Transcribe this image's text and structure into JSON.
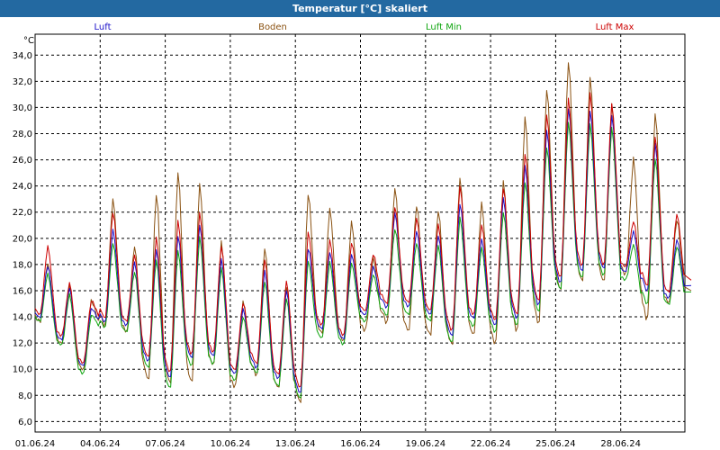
{
  "window": {
    "title": "Temperatur [°C] skaliert"
  },
  "colors": {
    "frame_bg": "#2369a1",
    "Luft": "#1a0fc8",
    "Boden": "#8a5212",
    "Luft Min": "#10a510",
    "Luft Max": "#cc0000"
  },
  "chart_data": {
    "type": "line",
    "title": "Temperatur [°C] skaliert",
    "ylabel": "°C",
    "xlabel": "",
    "ylim": [
      5.2,
      35.6
    ],
    "xlim": [
      "01.06.24",
      "01.07.24 06:00"
    ],
    "grid": true,
    "legend_placement": "top",
    "y_ticks": [
      "6,0",
      "8,0",
      "10,0",
      "12,0",
      "14,0",
      "16,0",
      "18,0",
      "20,0",
      "22,0",
      "24,0",
      "26,0",
      "28,0",
      "30,0",
      "32,0",
      "34,0"
    ],
    "x_ticks": [
      "01.06.24",
      "04.06.24",
      "07.06.24",
      "10.06.24",
      "13.06.24",
      "16.06.24",
      "19.06.24",
      "22.06.24",
      "25.06.24",
      "28.06.24"
    ],
    "x": [
      "01.06.24",
      "02.06.24",
      "03.06.24",
      "04.06.24",
      "05.06.24",
      "06.06.24",
      "07.06.24",
      "08.06.24",
      "09.06.24",
      "10.06.24",
      "11.06.24",
      "12.06.24",
      "13.06.24",
      "14.06.24",
      "15.06.24",
      "16.06.24",
      "17.06.24",
      "18.06.24",
      "19.06.24",
      "20.06.24",
      "21.06.24",
      "22.06.24",
      "23.06.24",
      "24.06.24",
      "25.06.24",
      "26.06.24",
      "27.06.24",
      "28.06.24",
      "29.06.24",
      "30.06.24"
    ],
    "series": [
      {
        "name": "Luft",
        "min": [
          13.9,
          12.2,
          10.2,
          13.5,
          13.3,
          10.5,
          9.2,
          10.7,
          10.9,
          9.6,
          10.0,
          9.2,
          8.0,
          13.0,
          12.2,
          14.1,
          14.6,
          14.7,
          14.1,
          12.4,
          13.8,
          13.2,
          13.7,
          14.7,
          16.4,
          17.3,
          17.5,
          17.4,
          15.8,
          15.4
        ],
        "max": [
          18.0,
          16.3,
          14.7,
          20.8,
          18.3,
          19.4,
          20.5,
          21.3,
          18.6,
          14.7,
          17.7,
          16.2,
          19.5,
          19.1,
          18.9,
          17.9,
          22.1,
          20.7,
          20.4,
          22.9,
          20.1,
          23.3,
          25.8,
          28.6,
          30.3,
          30.1,
          29.7,
          20.6,
          27.5,
          20.0
        ]
      },
      {
        "name": "Boden",
        "min": [
          13.6,
          11.9,
          9.9,
          13.2,
          12.8,
          9.0,
          8.7,
          8.8,
          10.2,
          8.6,
          9.4,
          8.5,
          7.2,
          12.6,
          12.0,
          12.9,
          13.4,
          12.8,
          12.5,
          11.7,
          12.5,
          11.8,
          12.7,
          13.2,
          15.8,
          16.5,
          16.5,
          17.1,
          13.6,
          15.0
        ],
        "max": [
          18.2,
          16.5,
          15.3,
          23.2,
          19.6,
          23.8,
          25.5,
          24.5,
          19.9,
          15.3,
          19.5,
          16.6,
          23.8,
          22.5,
          21.4,
          18.6,
          24.1,
          22.8,
          22.4,
          24.9,
          22.9,
          24.6,
          29.7,
          31.9,
          34.0,
          32.7,
          30.5,
          26.3,
          29.9,
          21.6
        ]
      },
      {
        "name": "Luft Min",
        "min": [
          13.6,
          11.8,
          9.6,
          13.1,
          12.8,
          10.0,
          8.4,
          10.1,
          10.3,
          9.1,
          9.6,
          8.6,
          7.6,
          12.3,
          11.8,
          13.6,
          14.0,
          14.1,
          13.6,
          11.9,
          13.2,
          12.7,
          13.2,
          14.2,
          15.9,
          16.8,
          17.0,
          16.8,
          14.8,
          14.9
        ],
        "max": [
          17.4,
          15.8,
          14.2,
          19.8,
          17.6,
          18.6,
          19.3,
          20.3,
          17.9,
          14.1,
          16.9,
          15.6,
          18.5,
          18.3,
          18.2,
          17.3,
          20.9,
          19.8,
          19.6,
          21.8,
          19.4,
          22.2,
          24.6,
          27.3,
          29.2,
          29.0,
          28.7,
          19.6,
          26.4,
          19.5
        ]
      },
      {
        "name": "Luft Max",
        "min": [
          14.1,
          12.5,
          10.4,
          13.8,
          13.6,
          10.8,
          9.6,
          11.0,
          11.2,
          9.9,
          10.3,
          9.5,
          8.4,
          13.3,
          12.5,
          14.4,
          14.9,
          15.0,
          14.4,
          12.8,
          14.1,
          13.6,
          14.0,
          15.0,
          16.8,
          17.7,
          17.8,
          17.8,
          16.2,
          15.8
        ],
        "max": [
          19.5,
          16.7,
          15.3,
          22.2,
          18.9,
          20.3,
          21.6,
          22.2,
          19.6,
          15.2,
          18.6,
          16.9,
          20.7,
          20.0,
          19.8,
          18.9,
          22.6,
          21.7,
          21.2,
          24.2,
          21.2,
          24.1,
          26.8,
          29.8,
          31.0,
          31.4,
          30.6,
          21.4,
          28.1,
          22.0
        ]
      }
    ]
  }
}
